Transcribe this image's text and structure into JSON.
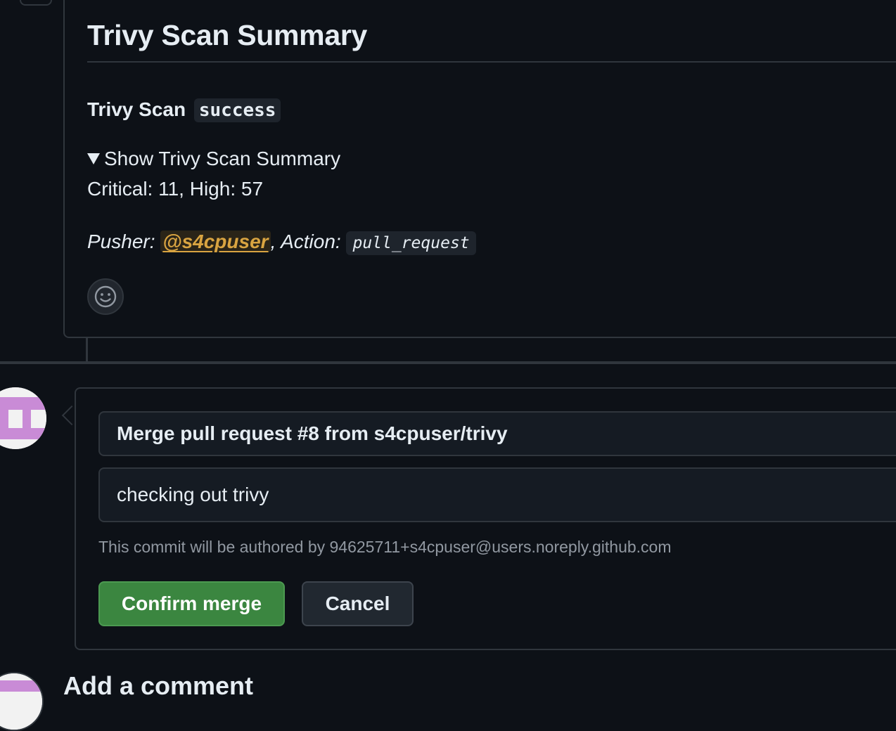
{
  "comment": {
    "title": "Trivy Scan Summary",
    "scan_label": "Trivy Scan",
    "scan_status": "success",
    "details_summary": "Show Trivy Scan Summary",
    "counts": "Critical: 11, High: 57",
    "pusher_label": "Pusher:",
    "pusher_mention": "@s4cpuser",
    "action_label": ", Action:",
    "action_value": "pull_request",
    "reaction_icon": "smiley-icon"
  },
  "merge": {
    "commit_title": "Merge pull request #8 from s4cpuser/trivy",
    "commit_body": "checking out trivy",
    "author_note": "This commit will be authored by 94625711+s4cpuser@users.noreply.github.com",
    "confirm_label": "Confirm merge",
    "cancel_label": "Cancel"
  },
  "bottom": {
    "heading": "Add a comment"
  },
  "colors": {
    "background": "#0d1117",
    "border": "#30363d",
    "confirm_green": "#3b8640",
    "mention": "#d9a441",
    "avatar_pink": "#c98bd6"
  }
}
